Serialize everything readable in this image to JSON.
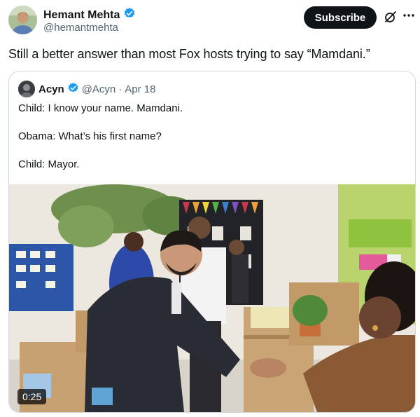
{
  "post": {
    "author_name": "Hemant Mehta",
    "author_handle": "@hemantmehta",
    "subscribe_label": "Subscribe",
    "text": "Still a better answer than most Fox hosts trying to say “Mamdani.”",
    "verified_color": "#1d9bf0"
  },
  "quoted": {
    "name": "Acyn",
    "handle": "@Acyn",
    "separator": "·",
    "date": "Apr 18",
    "lines": [
      "Child: I know your name. Mamdani.",
      "Obama: What’s his first name?",
      "Child: Mayor."
    ],
    "video_timestamp": "0:25"
  },
  "icons": {
    "verified": "verified-badge-icon",
    "grok": "grok-icon",
    "more": "more-options-icon"
  }
}
